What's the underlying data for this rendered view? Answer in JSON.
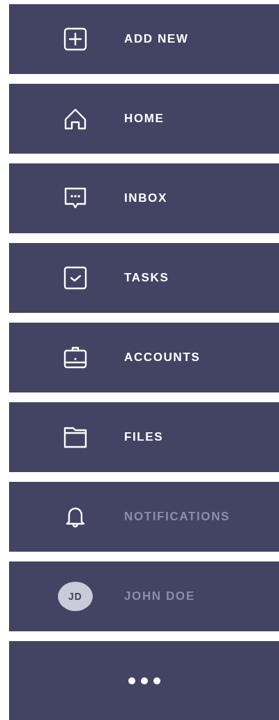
{
  "menu": [
    {
      "kind": "icon",
      "label": "ADD NEW",
      "muted": false
    },
    {
      "kind": "icon",
      "label": "HOME",
      "muted": false
    },
    {
      "kind": "icon",
      "label": "INBOX",
      "muted": false
    },
    {
      "kind": "icon",
      "label": "TASKS",
      "muted": false
    },
    {
      "kind": "icon",
      "label": "ACCOUNTS",
      "muted": false
    },
    {
      "kind": "icon",
      "label": "FILES",
      "muted": false
    },
    {
      "kind": "icon",
      "label": "NOTIFICATIONS",
      "muted": true
    },
    {
      "kind": "avatar",
      "initials": "JD",
      "label": "JOHN DOE",
      "muted": true
    },
    {
      "kind": "more"
    }
  ]
}
